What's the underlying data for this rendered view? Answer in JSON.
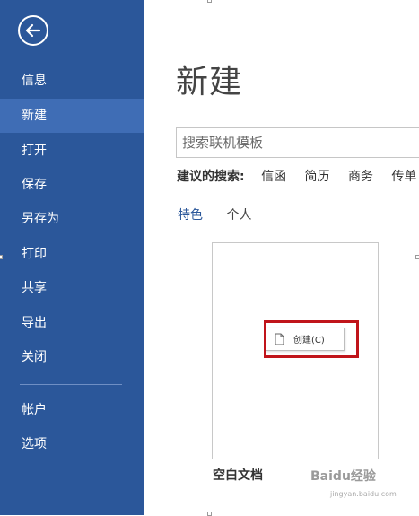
{
  "sidebar": {
    "back_icon": "back-arrow-circle-icon",
    "items": [
      {
        "label": "信息"
      },
      {
        "label": "新建"
      },
      {
        "label": "打开"
      },
      {
        "label": "保存"
      },
      {
        "label": "另存为"
      },
      {
        "label": "打印"
      },
      {
        "label": "共享"
      },
      {
        "label": "导出"
      },
      {
        "label": "关闭"
      },
      {
        "label": "帐户"
      },
      {
        "label": "选项"
      }
    ],
    "active_item": "新建",
    "bg_color": "#2b579a",
    "active_color": "#3f6db5"
  },
  "main": {
    "title": "新建",
    "search": {
      "placeholder": "搜索联机模板"
    },
    "suggestions": {
      "label": "建议的搜索:",
      "tags": [
        "信函",
        "简历",
        "商务",
        "传单"
      ]
    },
    "tabs": [
      "特色",
      "个人"
    ],
    "active_tab": "特色",
    "template": {
      "name": "空白文档"
    },
    "context_menu": {
      "create_label": "创建(C)"
    }
  },
  "watermark": {
    "text": "Baidu经验",
    "subtext": "jingyan.baidu.com"
  },
  "highlight_color": "#c0141a"
}
